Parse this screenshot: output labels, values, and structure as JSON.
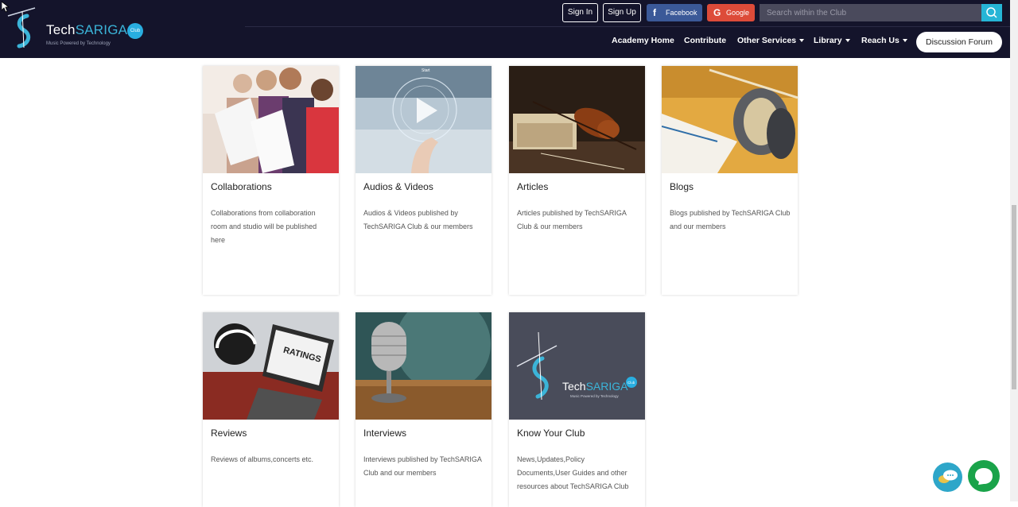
{
  "header": {
    "logo_text_a": "Tech",
    "logo_text_b": "SARIGA",
    "logo_club": "Club",
    "logo_tagline": "Music Powered by Technology",
    "sign_in": "Sign In",
    "sign_up": "Sign Up",
    "facebook": "Facebook",
    "google": "Google",
    "search_placeholder": "Search within the Club",
    "nav": {
      "academy_home": "Academy Home",
      "contribute": "Contribute",
      "other_services": "Other Services",
      "library": "Library",
      "reach_us": "Reach Us"
    },
    "discussion_forum": "Discussion Forum"
  },
  "cards": [
    {
      "title": "Collaborations",
      "desc": "Collaborations from collaboration room and studio will be published here"
    },
    {
      "title": "Audios & Videos",
      "desc": "Audios & Videos published by TechSARIGA Club & our members"
    },
    {
      "title": "Articles",
      "desc": "Articles published by TechSARIGA Club & our members"
    },
    {
      "title": "Blogs",
      "desc": "Blogs published by TechSARIGA Club and our members"
    },
    {
      "title": "Reviews",
      "desc": "Reviews of albums,concerts etc."
    },
    {
      "title": "Interviews",
      "desc": "Interviews published by TechSARIGA Club and our members"
    },
    {
      "title": "Know Your Club",
      "desc": "News,Updates,Policy Documents,User Guides and other resources about TechSARIGA Club"
    }
  ],
  "images": {
    "audio_video_label": "Start",
    "reviews_label": "RATINGS",
    "club_logo_a": "Tech",
    "club_logo_b": "SARIGA",
    "club_logo_club": "Club",
    "club_logo_tagline": "Music Powered by Technology"
  },
  "colors": {
    "header_bg": "#14142b",
    "accent": "#26b5d6",
    "facebook": "#3b5998",
    "google": "#dd4b39",
    "chat_green": "#1aa34a"
  }
}
